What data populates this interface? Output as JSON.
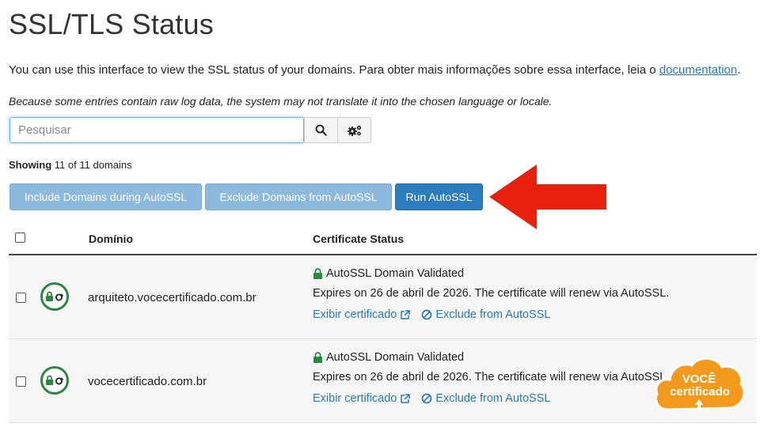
{
  "page": {
    "title": "SSL/TLS Status",
    "intro_text": "You can use this interface to view the SSL status of your domains. Para obter mais informações sobre essa interface, leia o ",
    "intro_link": "documentation",
    "intro_end": ".",
    "note": "Because some entries contain raw log data, the system may not translate it into the chosen language or locale."
  },
  "search": {
    "placeholder": "Pesquisar",
    "value": ""
  },
  "showing": {
    "label": "Showing",
    "text": "11 of 11 domains"
  },
  "actions": {
    "include_label": "Include Domains during AutoSSL",
    "exclude_label": "Exclude Domains from AutoSSL",
    "run_label": "Run AutoSSL"
  },
  "table": {
    "headers": {
      "domain": "Domínio",
      "status": "Certificate Status"
    },
    "rows": [
      {
        "domain": "arquiteto.vocecertificado.com.br",
        "status": "AutoSSL Domain Validated",
        "expiry": "Expires on 26 de abril de 2026. The certificate will renew via AutoSSL.",
        "view_link": "Exibir certificado",
        "exclude_link": "Exclude from AutoSSL"
      },
      {
        "domain": "vocecertificado.com.br",
        "status": "AutoSSL Domain Validated",
        "expiry": "Expires on 26 de abril de 2026. The certificate will renew via AutoSSL.",
        "view_link": "Exibir certificado",
        "exclude_link": "Exclude from AutoSSL"
      }
    ]
  },
  "watermark": {
    "line1": "VOCÊ",
    "line2": "certificado"
  },
  "colors": {
    "accent": "#2c7dbf",
    "accent_light": "#8db9dd",
    "link": "#2a7ab0",
    "success": "#2e8540",
    "arrow": "#e8210f",
    "badge": "#f39a1d"
  },
  "icons": {
    "search": "search-icon",
    "settings": "gears-icon",
    "lock": "lock-icon",
    "external": "external-link-icon",
    "block": "ban-icon",
    "status": "lock-refresh-icon"
  }
}
